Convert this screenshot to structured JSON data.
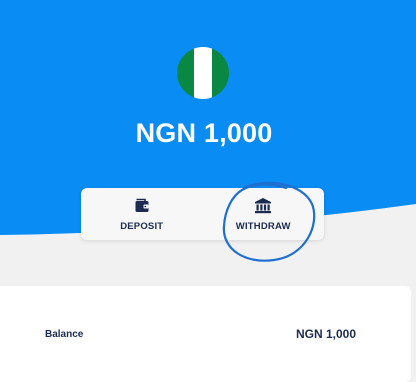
{
  "header": {
    "amount": "NGN 1,000",
    "bg_color": "#0a8cf5",
    "flag": {
      "colors": [
        "#0b8744",
        "#ffffff",
        "#0b8744"
      ],
      "icon": "nigeria-flag-icon"
    }
  },
  "actions": [
    {
      "label": "DEPOSIT",
      "icon": "wallet-icon"
    },
    {
      "label": "WITHDRAW",
      "icon": "bank-icon"
    }
  ],
  "annotation": {
    "color": "#1f6fd1",
    "icon": "hand-drawn-circle"
  },
  "balance": {
    "label": "Balance",
    "value": "NGN 1,000"
  }
}
